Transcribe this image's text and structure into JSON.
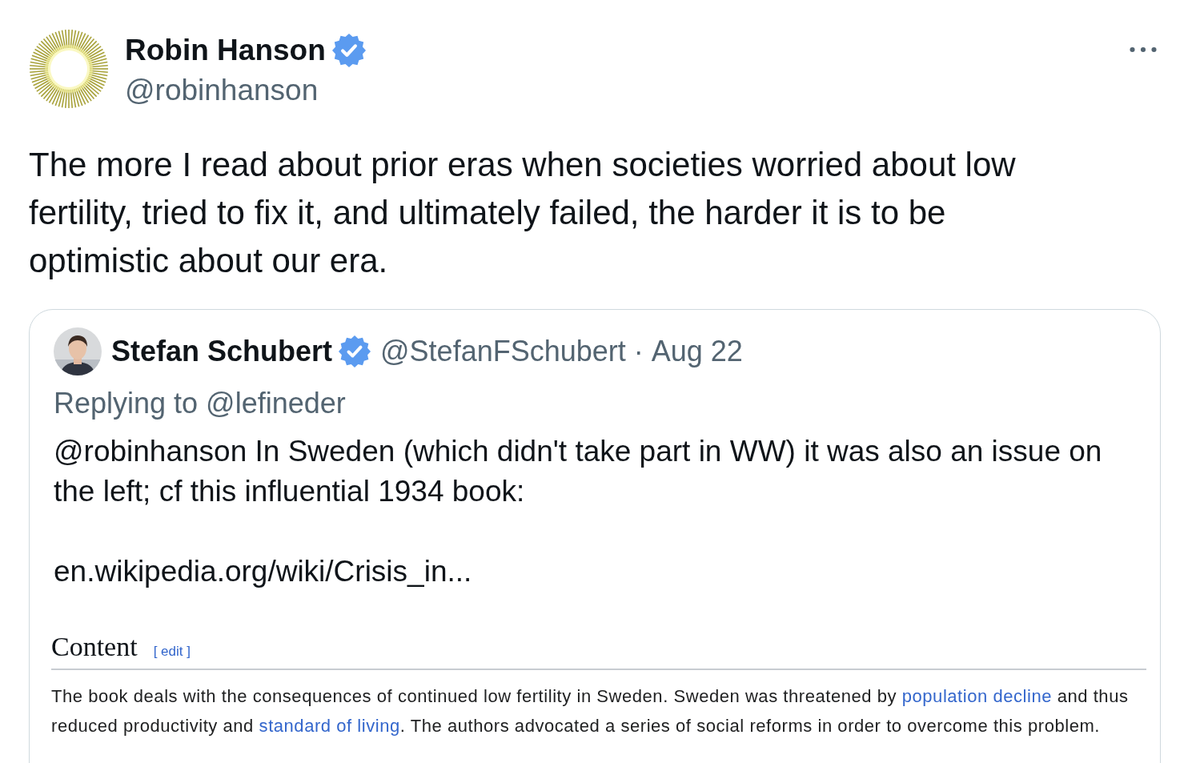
{
  "author": {
    "name": "Robin Hanson",
    "verified": true,
    "handle": "@robinhanson"
  },
  "text": "The more I read about prior eras when societies worried about low fertility, tried to fix it, and ultimately failed, the harder it is to be optimistic about our era.",
  "quoted_tweet": {
    "author": {
      "name": "Stefan Schubert",
      "verified": true,
      "handle": "@StefanFSchubert",
      "separator": "·",
      "date": "Aug 22"
    },
    "replying_to": "Replying to @lefineder",
    "text": "@robinhanson In Sweden (which didn't take part in WW) it was also an issue on the left; cf this influential 1934 book:",
    "url": "en.wikipedia.org/wiki/Crisis_in...",
    "image": {
      "heading": "Content",
      "edit_link": "[ edit ]",
      "paragraph": [
        {
          "text": "The book deals with the consequences of continued low fertility in Sweden. Sweden was threatened by ",
          "link": false
        },
        {
          "text": "population decline",
          "link": true
        },
        {
          "text": " and thus reduced productivity and ",
          "link": false
        },
        {
          "text": "standard of living",
          "link": true
        },
        {
          "text": ". The authors advocated a series of social reforms in order to overcome this problem.",
          "link": false
        }
      ]
    }
  }
}
